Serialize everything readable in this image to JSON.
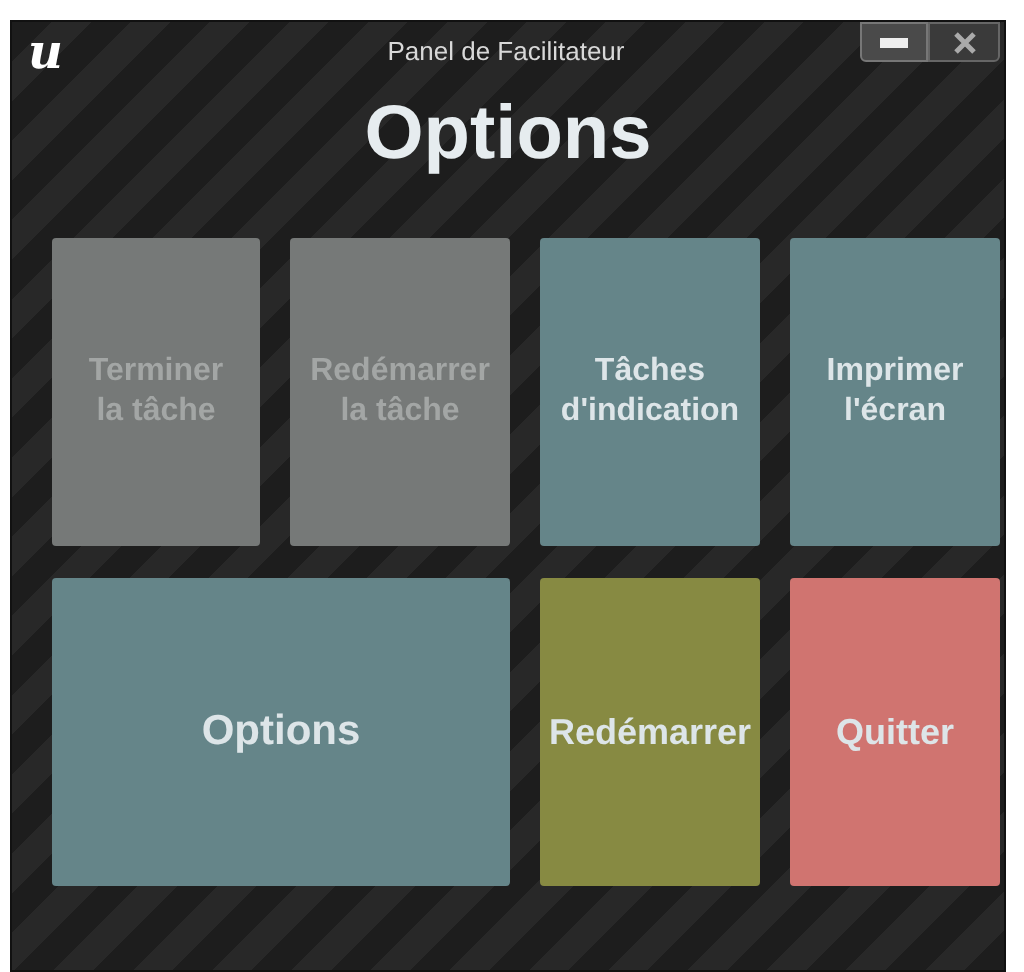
{
  "window": {
    "logo": "u",
    "title": "Panel de Facilitateur",
    "controls": [
      {
        "kind": "minimize"
      },
      {
        "kind": "close"
      }
    ]
  },
  "heading": "Options",
  "buttons": [
    {
      "label": "Terminer la tâche",
      "kind": "tile",
      "disabled": true,
      "color": "#767978"
    },
    {
      "label": "Redémarrer la tâche",
      "kind": "tile",
      "disabled": true,
      "color": "#767978"
    },
    {
      "label": "Tâches d'indication",
      "kind": "tile",
      "disabled": false,
      "color": "#658589"
    },
    {
      "label": "Imprimer l'écran",
      "kind": "tile",
      "disabled": false,
      "color": "#658589"
    },
    {
      "label": "Options",
      "kind": "wide",
      "disabled": false,
      "color": "#658589"
    },
    {
      "label": "Redémarrer",
      "kind": "tile",
      "disabled": false,
      "color": "#878a42"
    },
    {
      "label": "Quitter",
      "kind": "tile",
      "disabled": false,
      "color": "#d07470"
    }
  ]
}
